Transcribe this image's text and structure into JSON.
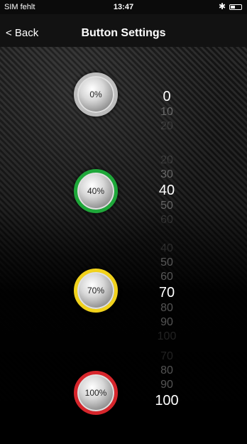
{
  "status_bar": {
    "carrier": "SIM fehlt",
    "time": "13:47",
    "bluetooth_icon": "bluetooth-icon",
    "battery_icon": "battery-icon"
  },
  "nav": {
    "back_label": "< Back",
    "title": "Button Settings"
  },
  "buttons": [
    {
      "label": "0%",
      "ring_color": "#bdbdbd",
      "selected_value": "0",
      "picker": [
        "0",
        "10",
        "20"
      ]
    },
    {
      "label": "40%",
      "ring_color": "#1fa83a",
      "selected_value": "40",
      "picker": [
        "20",
        "30",
        "40",
        "50",
        "60"
      ]
    },
    {
      "label": "70%",
      "ring_color": "#f1d21c",
      "selected_value": "70",
      "picker": [
        "40",
        "50",
        "60",
        "70",
        "80",
        "90",
        "100"
      ]
    },
    {
      "label": "100%",
      "ring_color": "#d7262c",
      "selected_value": "100",
      "picker": [
        "70",
        "80",
        "90",
        "100"
      ]
    }
  ]
}
